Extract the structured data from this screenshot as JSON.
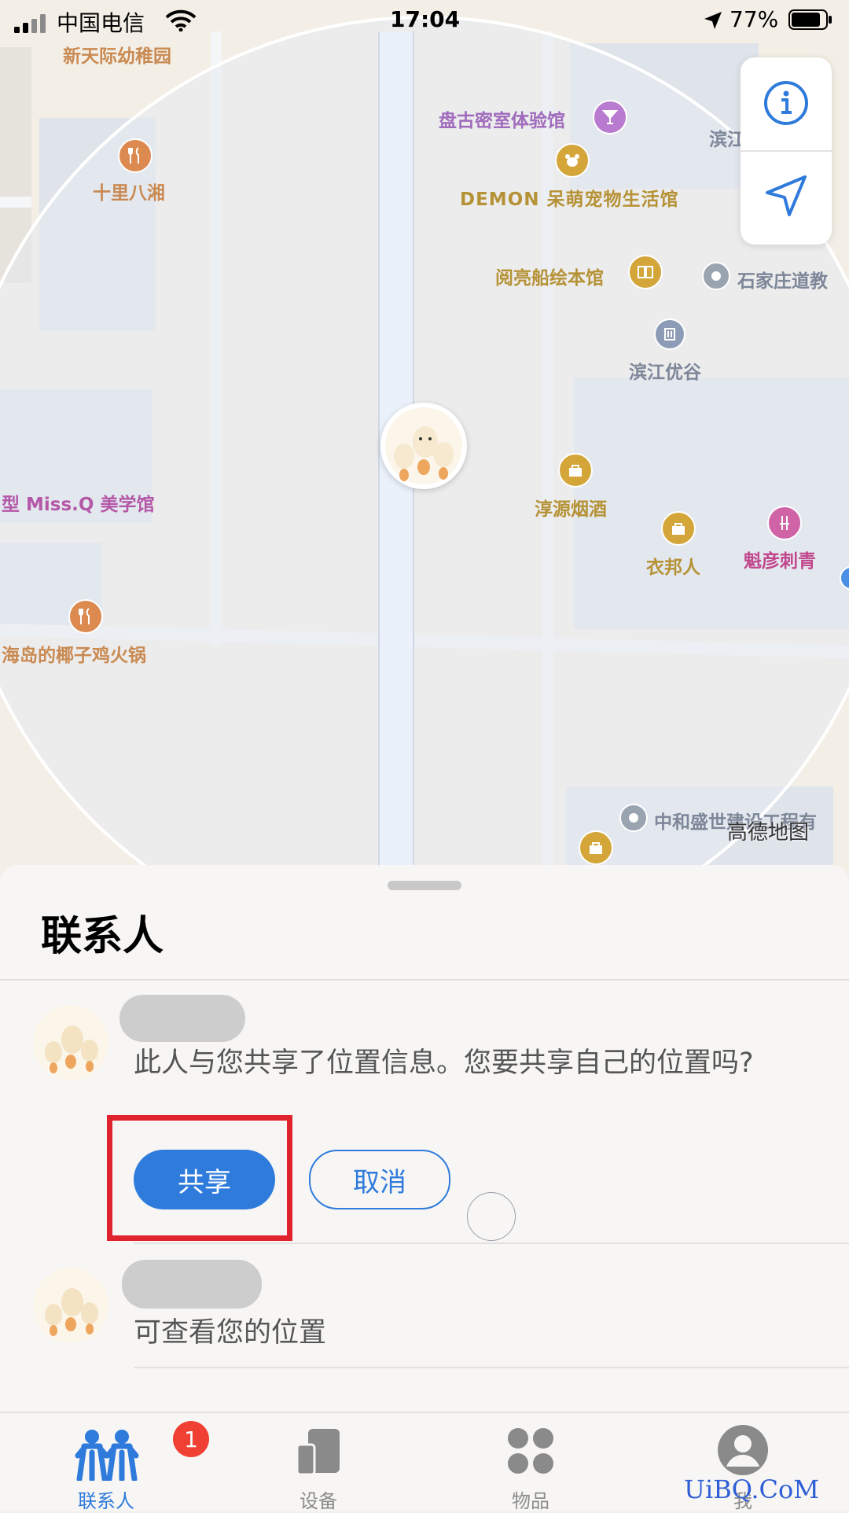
{
  "status_bar": {
    "carrier": "中国电信",
    "time": "17:04",
    "battery": "77%"
  },
  "map": {
    "pois": [
      {
        "key": "kindergarten",
        "label": "新天际幼稚园",
        "icon": "school-icon"
      },
      {
        "key": "shili",
        "label": "十里八湘",
        "icon": "restaurant-icon"
      },
      {
        "key": "pangu",
        "label": "盘古密室体验馆",
        "icon": "cocktail-icon"
      },
      {
        "key": "binjiang_top",
        "label": "滨江",
        "icon": ""
      },
      {
        "key": "demon",
        "label": "DEMON 呆萌宠物生活馆",
        "icon": "pet-icon"
      },
      {
        "key": "yueliang",
        "label": "阅亮船绘本馆",
        "icon": "book-icon"
      },
      {
        "key": "shijiazhuang",
        "label": "石家庄道教",
        "icon": "place-icon"
      },
      {
        "key": "binjiang_yougu",
        "label": "滨江优谷",
        "icon": "building-icon"
      },
      {
        "key": "missq",
        "label": "型 Miss.Q 美学馆",
        "icon": ""
      },
      {
        "key": "chunyuan",
        "label": "淳源烟酒",
        "icon": "shopping-bag-icon"
      },
      {
        "key": "yibang",
        "label": "衣邦人",
        "icon": "shopping-bag-icon"
      },
      {
        "key": "kuiyan",
        "label": "魁彦刺青",
        "icon": "tattoo-icon"
      },
      {
        "key": "haidao",
        "label": "海岛的椰子鸡火锅",
        "icon": "restaurant-icon"
      },
      {
        "key": "zhonghe",
        "label": "中和盛世建设工程有",
        "icon": "place-icon"
      }
    ],
    "attribution": "高德地图"
  },
  "sheet": {
    "title": "联系人",
    "contacts": [
      {
        "message": "此人与您共享了位置信息。您要共享自己的位置吗?",
        "share_label": "共享",
        "cancel_label": "取消"
      },
      {
        "message": "可查看您的位置"
      }
    ]
  },
  "tabbar": {
    "tabs": [
      {
        "label": "联系人",
        "icon": "people-icon",
        "active": true,
        "badge": "1"
      },
      {
        "label": "设备",
        "icon": "devices-icon",
        "active": false
      },
      {
        "label": "物品",
        "icon": "items-icon",
        "active": false
      },
      {
        "label": "我",
        "icon": "person-icon",
        "active": false
      }
    ]
  },
  "watermark": "UiBQ.CoM",
  "colors": {
    "accent": "#2f7bdc",
    "highlight_box": "#e0232c",
    "badge": "#f04034"
  }
}
